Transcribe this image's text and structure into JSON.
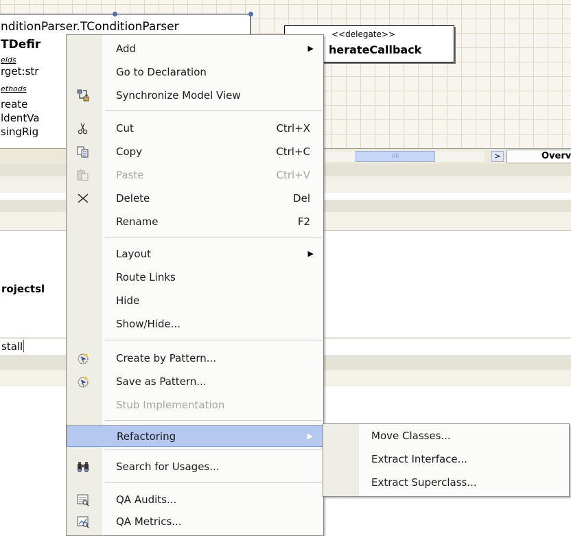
{
  "diagram": {
    "class_header": "nditionParser.TConditionParser",
    "class_name": "TDefir",
    "fields_label": "elds",
    "field_1": "rget:str",
    "methods_label": "ethods",
    "method_1": "reate",
    "method_2": "ldentVa",
    "method_3": "singRig",
    "delegate_stereotype": "<<delegate>>",
    "delegate_name": "herateCallback"
  },
  "scrollbar": {
    "thumb_grip": "IIII",
    "arrow_label": ">",
    "tab_label": "Overvie"
  },
  "panel": {
    "title": "rojectsl",
    "field_text": "stall"
  },
  "context_menu": {
    "items": [
      {
        "label": "Add",
        "shortcut": "",
        "icon": "none"
      },
      {
        "label": "Go to Declaration",
        "shortcut": "",
        "icon": "none"
      },
      {
        "label": "Synchronize Model View",
        "shortcut": "",
        "icon": "sync-model-icon"
      },
      {
        "label": "Cut",
        "shortcut": "Ctrl+X",
        "icon": "scissors-icon"
      },
      {
        "label": "Copy",
        "shortcut": "Ctrl+C",
        "icon": "copy-icon"
      },
      {
        "label": "Paste",
        "shortcut": "Ctrl+V",
        "icon": "paste-icon"
      },
      {
        "label": "Delete",
        "shortcut": "Del",
        "icon": "delete-x-icon"
      },
      {
        "label": "Rename",
        "shortcut": "F2",
        "icon": "none"
      },
      {
        "label": "Layout",
        "shortcut": "",
        "icon": "none"
      },
      {
        "label": "Route Links",
        "shortcut": "",
        "icon": "none"
      },
      {
        "label": "Hide",
        "shortcut": "",
        "icon": "none"
      },
      {
        "label": "Show/Hide...",
        "shortcut": "",
        "icon": "none"
      },
      {
        "label": "Create by Pattern...",
        "shortcut": "",
        "icon": "create-pattern-icon"
      },
      {
        "label": "Save as Pattern...",
        "shortcut": "",
        "icon": "save-pattern-icon"
      },
      {
        "label": "Stub Implementation",
        "shortcut": "",
        "icon": "none"
      },
      {
        "label": "Refactoring",
        "shortcut": "",
        "icon": "none"
      },
      {
        "label": "Search for Usages...",
        "shortcut": "",
        "icon": "binoculars-icon"
      },
      {
        "label": "QA Audits...",
        "shortcut": "",
        "icon": "qa-audits-icon"
      },
      {
        "label": "QA Metrics...",
        "shortcut": "",
        "icon": "qa-metrics-icon"
      }
    ],
    "submenu_arrow": "▶"
  },
  "refactoring_submenu": {
    "items": [
      {
        "label": "Move Classes..."
      },
      {
        "label": "Extract Interface..."
      },
      {
        "label": "Extract Superclass..."
      }
    ]
  },
  "colors": {
    "highlight": "#b5c8ef",
    "highlight_border": "#7d9bd6",
    "gutter": "#efeee6",
    "disabled_text": "#a8a8a0"
  }
}
